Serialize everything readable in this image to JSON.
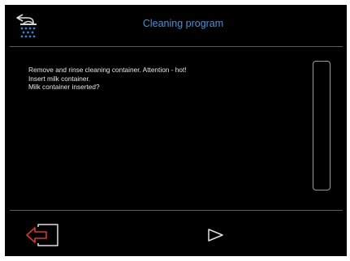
{
  "header": {
    "title": "Cleaning program",
    "icon": "cleaning-program-icon"
  },
  "message": {
    "lines": [
      "Remove and rinse cleaning container. Attention - hot!",
      "Insert milk container.",
      "Milk container inserted?"
    ]
  },
  "footer": {
    "exit_icon": "exit-icon",
    "next_icon": "next-arrow-icon"
  },
  "colors": {
    "background": "#000000",
    "title": "#4f8fd8",
    "icon_blue": "#3f7fd0",
    "exit_red": "#d23a32",
    "text": "#e8e8e8",
    "divider": "#5a5a5a"
  }
}
